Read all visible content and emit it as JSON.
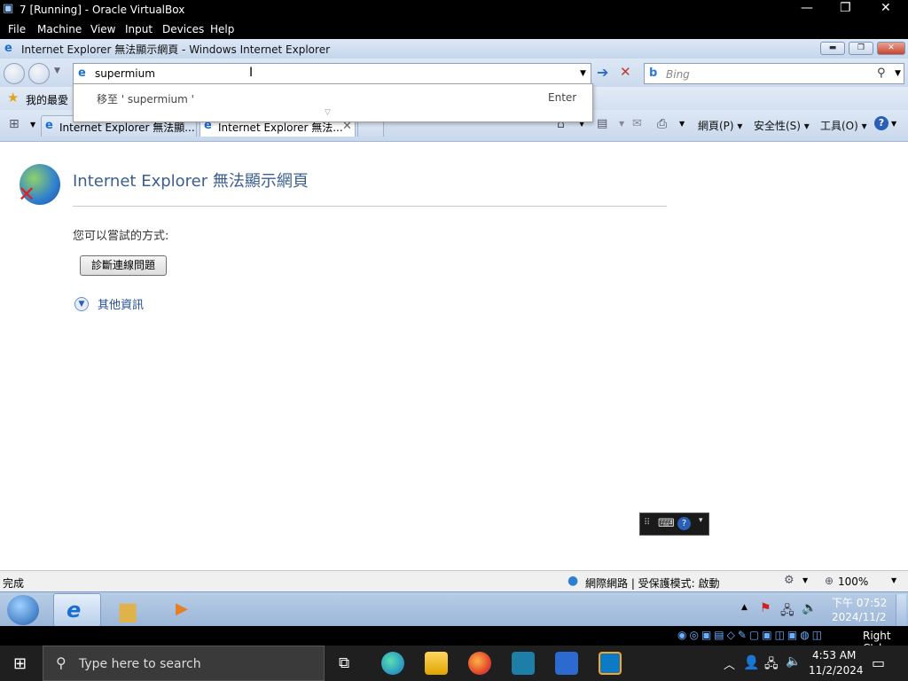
{
  "vbox": {
    "title": "7 [Running] - Oracle VirtualBox",
    "menu": [
      "File",
      "Machine",
      "View",
      "Input",
      "Devices",
      "Help"
    ],
    "host_key": "Right Ctrl"
  },
  "ie": {
    "window_title": "Internet Explorer 無法顯示網頁 - Windows Internet Explorer",
    "address_value": "supermium",
    "search_placeholder": "Bing",
    "favorites_label": "我的最愛",
    "tabs": [
      {
        "label": "Internet Explorer 無法顯...",
        "active": false
      },
      {
        "label": "Internet Explorer 無法...",
        "active": true
      }
    ],
    "commands": {
      "page": "網頁(P)",
      "safety": "安全性(S)",
      "tools": "工具(O)"
    },
    "dropdown": {
      "goto_text": "移至 ' supermium '",
      "enter_hint": "Enter"
    }
  },
  "page": {
    "heading": "Internet Explorer 無法顯示網頁",
    "try_text": "您可以嘗試的方式:",
    "diagnose_button": "診斷連線問題",
    "more_info": "其他資訊"
  },
  "statusbar": {
    "status": "完成",
    "zone": "網際網路 | 受保護模式: 啟動",
    "zoom": "100%"
  },
  "guest_clock": {
    "time": "下午 07:52",
    "date": "2024/11/2"
  },
  "host": {
    "search_placeholder": "Type here to search",
    "time": "4:53 AM",
    "date": "11/2/2024"
  },
  "colors": {
    "ie_link": "#1f4e99",
    "heading": "#3a5f8e",
    "win7_taskbar": "#9bb6d9"
  }
}
